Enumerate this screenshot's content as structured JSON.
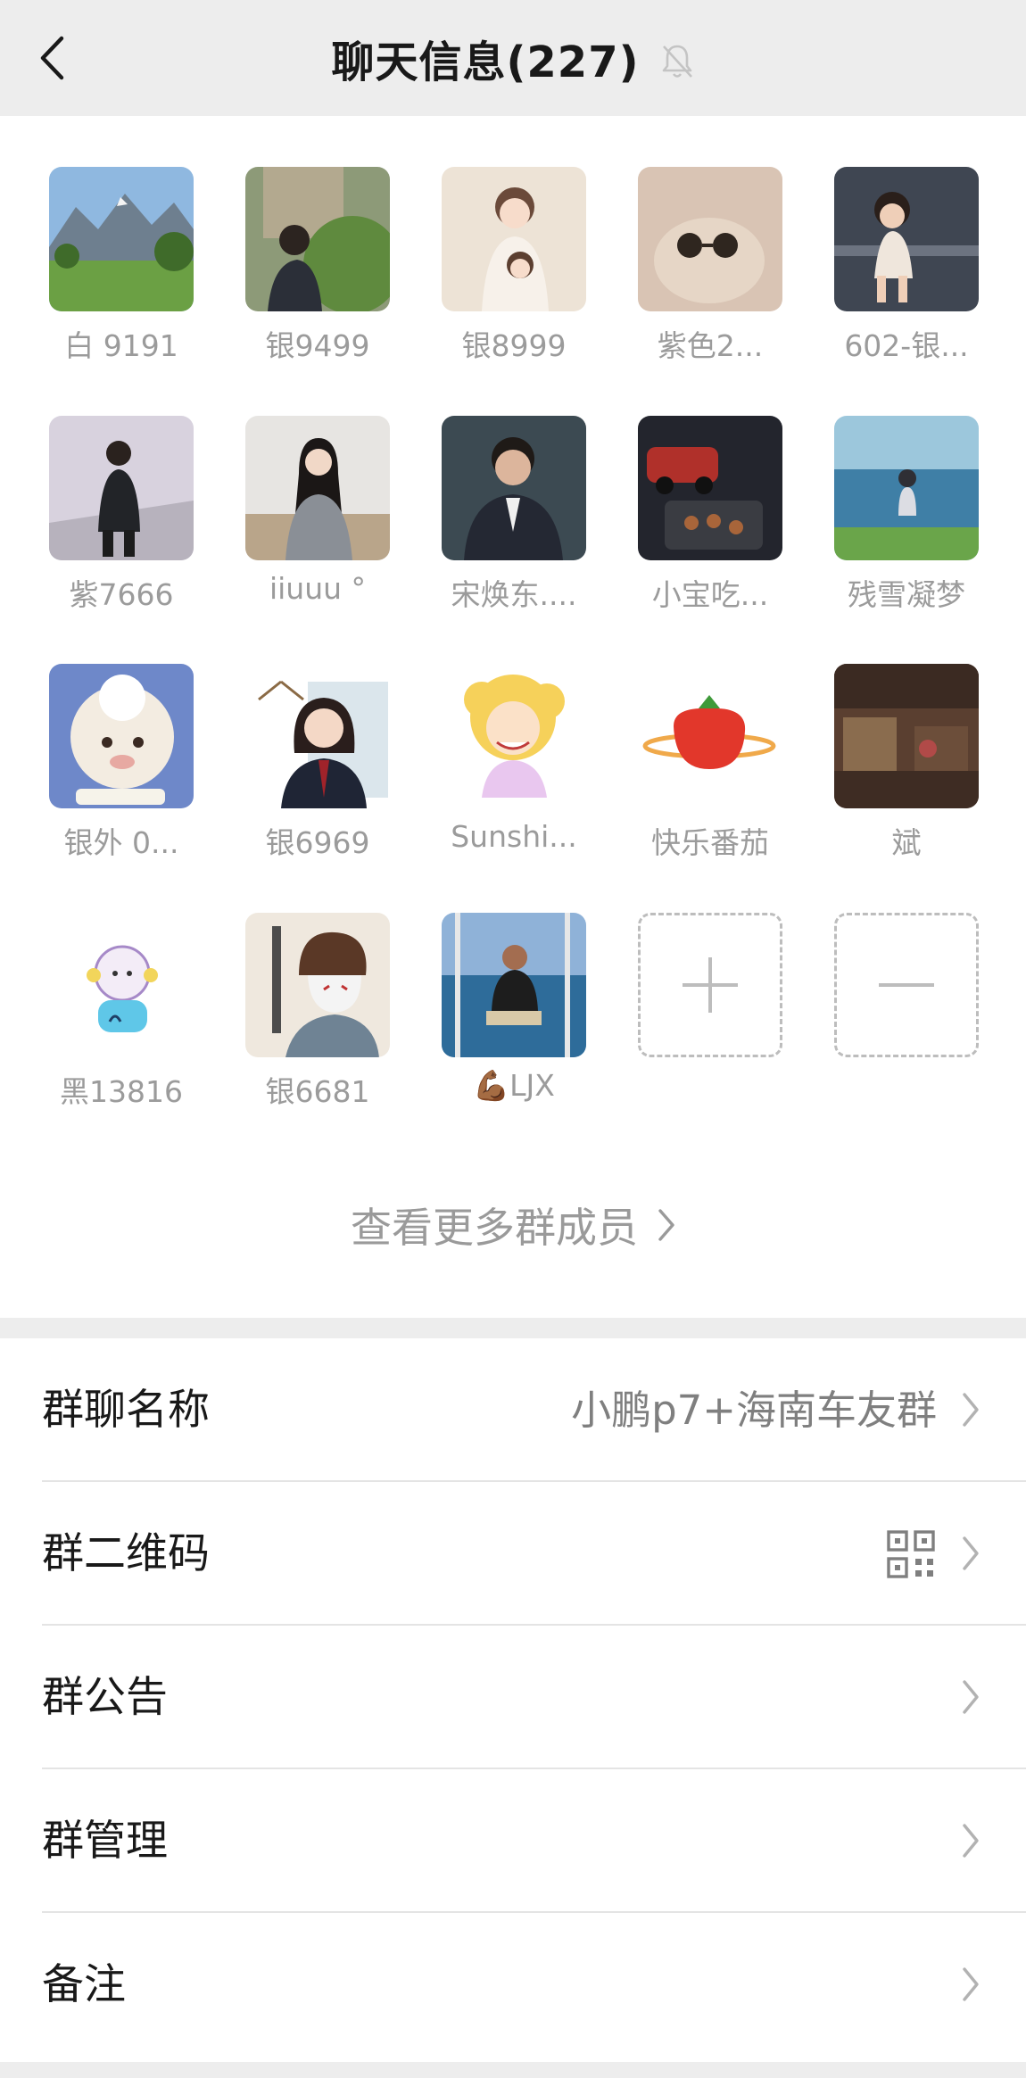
{
  "header": {
    "title": "聊天信息(227)",
    "back_icon": "chevron-left-icon",
    "mute_icon": "bell-off-icon"
  },
  "members": [
    {
      "name": "白 9191"
    },
    {
      "name": "银9499"
    },
    {
      "name": "银8999"
    },
    {
      "name": "紫色2..."
    },
    {
      "name": "602-银..."
    },
    {
      "name": "紫7666"
    },
    {
      "name": "iiuuu °"
    },
    {
      "name": "宋焕东...."
    },
    {
      "name": "小宝吃..."
    },
    {
      "name": "残雪凝梦"
    },
    {
      "name": "银外 0..."
    },
    {
      "name": "银6969"
    },
    {
      "name": "Sunshi..."
    },
    {
      "name": "快乐番茄"
    },
    {
      "name": "斌"
    },
    {
      "name": "黑13816"
    },
    {
      "name": "银6681"
    },
    {
      "name": "💪🏾LJX"
    }
  ],
  "actions": {
    "add_icon": "plus-icon",
    "remove_icon": "minus-icon"
  },
  "more_members_label": "查看更多群成员",
  "settings": {
    "group_name_label": "群聊名称",
    "group_name_value": "小鹏p7+海南车友群",
    "qr_label": "群二维码",
    "qr_icon": "qr-code-icon",
    "notice_label": "群公告",
    "manage_label": "群管理",
    "remark_label": "备注"
  },
  "colors": {
    "background": "#ededed",
    "panel": "#ffffff",
    "text_primary": "#191919",
    "text_secondary": "#9b9b9b"
  }
}
